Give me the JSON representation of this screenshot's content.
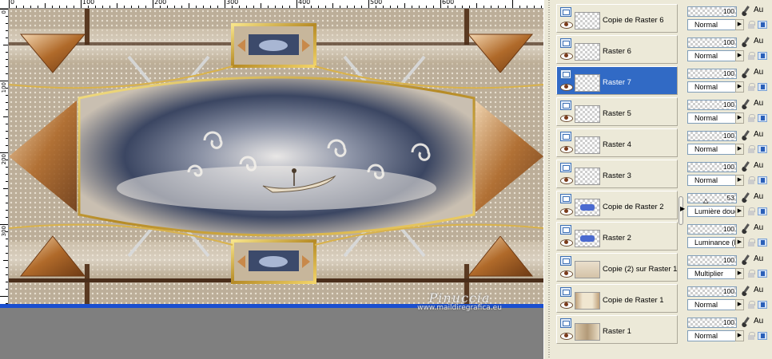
{
  "ruler": {
    "top_labels": [
      "0",
      "100",
      "200",
      "300",
      "400",
      "500",
      "600"
    ],
    "left_labels": [
      "0",
      "100",
      "200",
      "300"
    ]
  },
  "watermark": {
    "line1": "Pinuccia",
    "line2": "www.maildiregrafica.eu"
  },
  "layers": [
    {
      "name": "Copie de Raster 6",
      "thumb": "checker",
      "opacity": "100",
      "blend": "Normal",
      "selected": false
    },
    {
      "name": "Raster 6",
      "thumb": "checker",
      "opacity": "100",
      "blend": "Normal",
      "selected": false
    },
    {
      "name": "Raster 7",
      "thumb": "checker",
      "opacity": "100",
      "blend": "Normal",
      "selected": true
    },
    {
      "name": "Raster 5",
      "thumb": "checker",
      "opacity": "100",
      "blend": "Normal",
      "selected": false
    },
    {
      "name": "Raster 4",
      "thumb": "checker",
      "opacity": "100",
      "blend": "Normal",
      "selected": false
    },
    {
      "name": "Raster 3",
      "thumb": "checker",
      "opacity": "100",
      "blend": "Normal",
      "selected": false
    },
    {
      "name": "Copie de Raster 2",
      "thumb": "blue",
      "opacity": "53",
      "blend": "Lumière douce",
      "selected": false
    },
    {
      "name": "Raster 2",
      "thumb": "blue",
      "opacity": "100",
      "blend": "Luminance (H)",
      "selected": false
    },
    {
      "name": "Copie (2) sur Raster 1",
      "thumb": "copy2",
      "opacity": "100",
      "blend": "Multiplier",
      "selected": false
    },
    {
      "name": "Copie de Raster 1",
      "thumb": "frame",
      "opacity": "100",
      "blend": "Normal",
      "selected": false
    },
    {
      "name": "Raster 1",
      "thumb": "beige",
      "opacity": "100",
      "blend": "Normal",
      "selected": false
    }
  ],
  "au_label": "Au",
  "colors": {
    "selection": "#316ac5",
    "canvas_border": "#1a4fd0",
    "panel_bg": "#ece9d8"
  }
}
